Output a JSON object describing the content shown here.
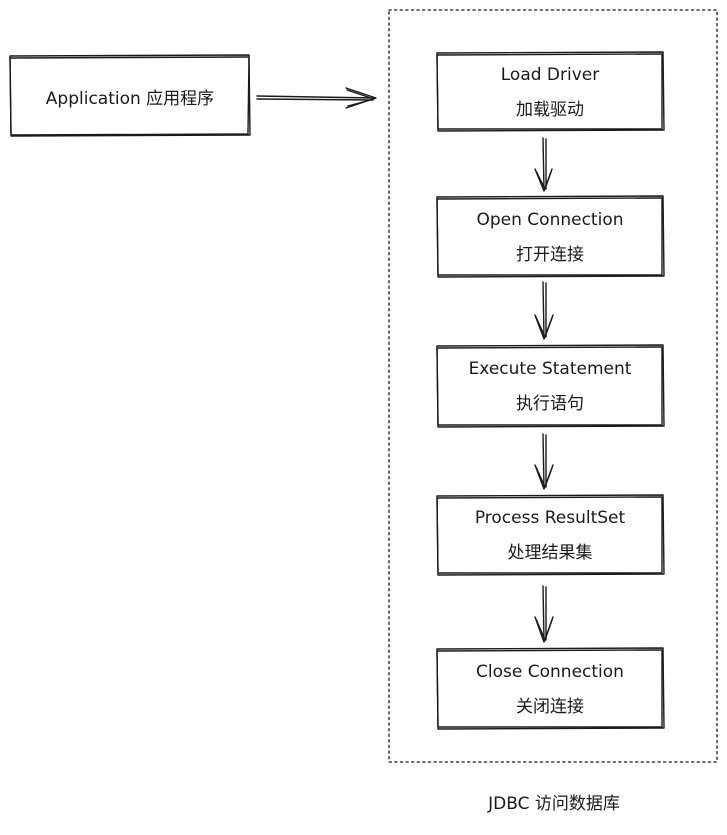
{
  "application": {
    "label": "Application 应用程序"
  },
  "jdbc_container": {
    "caption": "JDBC 访问数据库"
  },
  "steps": [
    {
      "title": "Load Driver",
      "subtitle": "加载驱动"
    },
    {
      "title": "Open Connection",
      "subtitle": "打开连接"
    },
    {
      "title": "Execute Statement",
      "subtitle": "执行语句"
    },
    {
      "title": "Process ResultSet",
      "subtitle": "处理结果集"
    },
    {
      "title": "Close Connection",
      "subtitle": "关闭连接"
    }
  ],
  "colors": {
    "stroke": "#1a1a1a",
    "background": "#ffffff"
  }
}
